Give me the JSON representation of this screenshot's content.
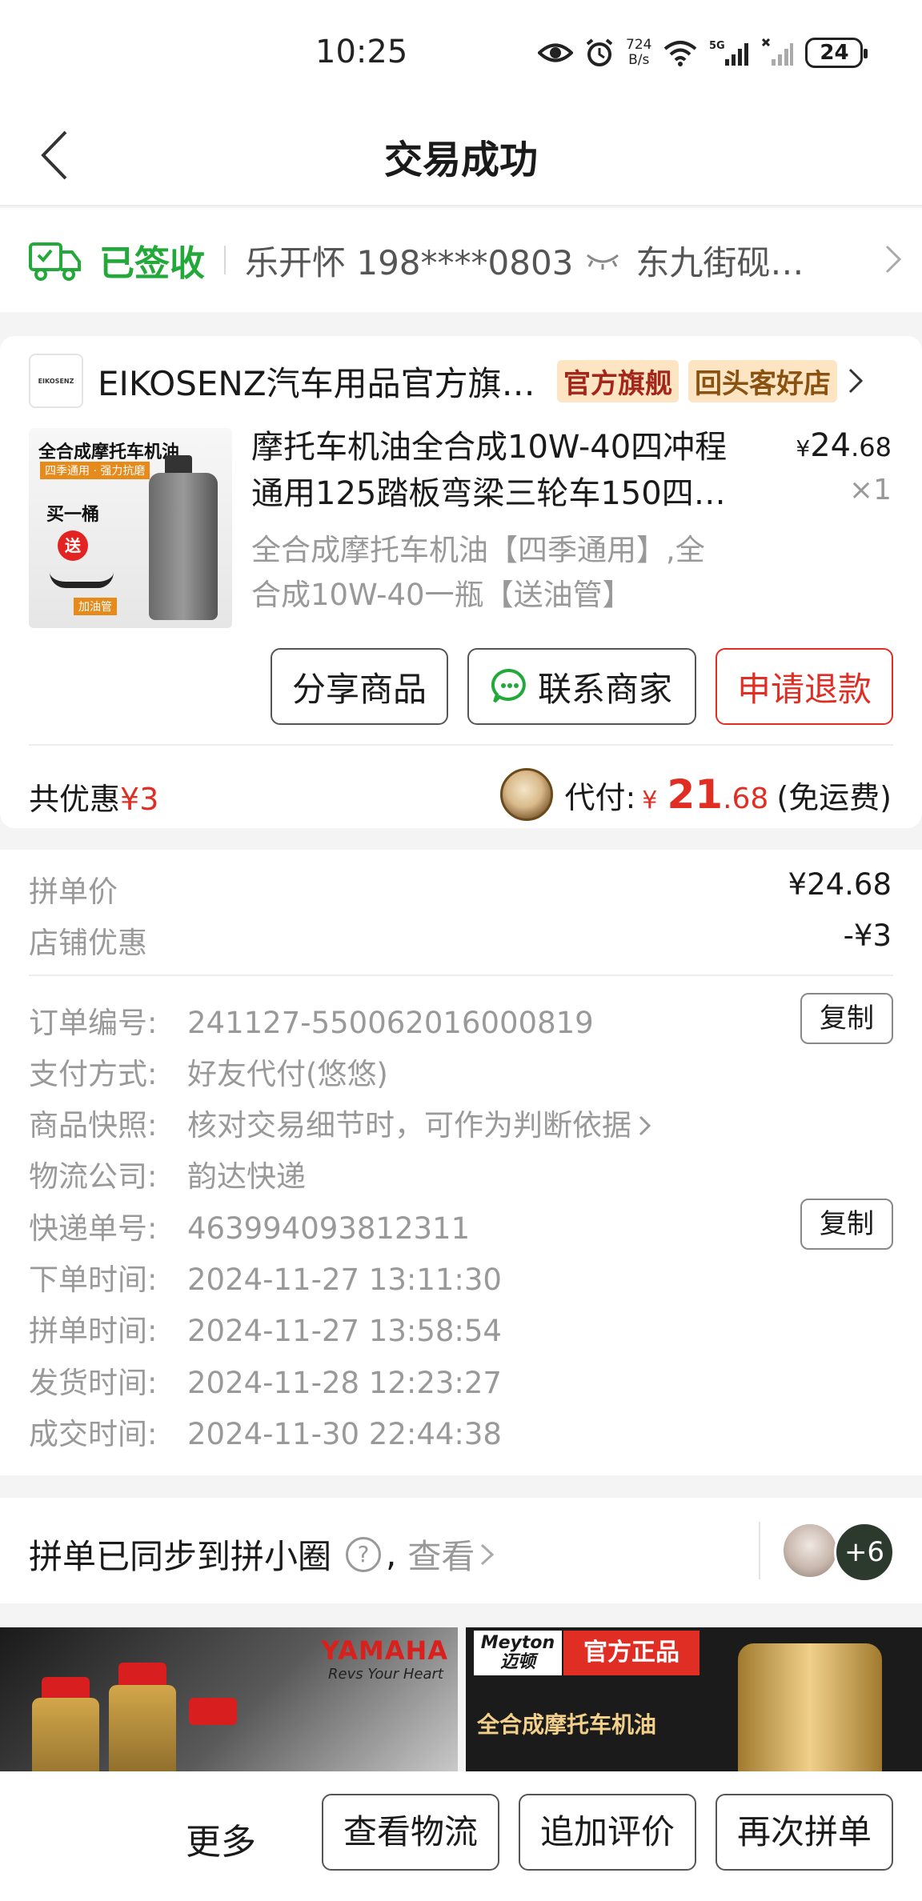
{
  "status_bar": {
    "time": "10:25",
    "net_speed_top": "724",
    "net_speed_bottom": "B/s",
    "signal": "5G",
    "battery": "24"
  },
  "header": {
    "title": "交易成功"
  },
  "delivery": {
    "status": "已签收",
    "recipient": "乐开怀 198****0803",
    "address": "东九街砚…"
  },
  "store": {
    "logo_text": "EIKOSENZ",
    "name": "EIKOSENZ汽车用品官方旗…",
    "tag_official": "官方旗舰",
    "tag_return": "回头客好店"
  },
  "product": {
    "image_title": "全合成摩托车机油",
    "image_sub": "四季通用 · 强力抗磨",
    "image_buy": "买一桶",
    "image_gift": "送",
    "image_tag": "加油管",
    "title_line1": "摩托车机油全合成10W-40四冲程",
    "title_line2": "通用125踏板弯梁三轮车150四…",
    "price_yen": "¥",
    "price_int": "24",
    "price_dec": ".68",
    "qty": "×1",
    "spec_line1": "全合成摩托车机油【四季通用】,全",
    "spec_line2": "合成10W-40一瓶【送油管】"
  },
  "actions": {
    "share": "分享商品",
    "contact": "联系商家",
    "refund": "申请退款"
  },
  "summary": {
    "discount_label": "共优惠",
    "discount_value": "¥3",
    "pay_label": "代付:",
    "pay_yen": "¥",
    "pay_int": "21",
    "pay_dec": ".68",
    "freeship": "(免运费)"
  },
  "pricing": [
    {
      "label": "拼单价",
      "value": "¥24.68"
    },
    {
      "label": "店铺优惠",
      "value": "-¥3"
    }
  ],
  "order_info": {
    "order_no_label": "订单编号:",
    "order_no": "241127-550062016000819",
    "pay_method_label": "支付方式:",
    "pay_method": "好友代付(悠悠)",
    "snapshot_label": "商品快照:",
    "snapshot": "核对交易细节时，可作为判断依据",
    "carrier_label": "物流公司:",
    "carrier": "韵达快递",
    "tracking_label": "快递单号:",
    "tracking": "463994093812311",
    "order_time_label": "下单时间:",
    "order_time": "2024-11-27 13:11:30",
    "group_time_label": "拼单时间:",
    "group_time": "2024-11-27 13:58:54",
    "ship_time_label": "发货时间:",
    "ship_time": "2024-11-28 12:23:27",
    "deal_time_label": "成交时间:",
    "deal_time": "2024-11-30 22:44:38",
    "copy_label": "复制"
  },
  "circle": {
    "text": "拼单已同步到拼小圈",
    "help": "?",
    "comma": ",",
    "view": "查看",
    "more_count": "+6"
  },
  "banners": {
    "left_brand": "YAMAHA",
    "left_slogan": "Revs Your Heart",
    "right_brand": "Meyton 迈顿",
    "right_tag": "官方正品",
    "right_title": "全合成摩托车机油"
  },
  "bottom_bar": {
    "more": "更多",
    "logistics": "查看物流",
    "review": "追加评价",
    "reorder": "再次拼单"
  },
  "colors": {
    "accent_red": "#e02e24",
    "delivered_green": "#23a83a"
  }
}
